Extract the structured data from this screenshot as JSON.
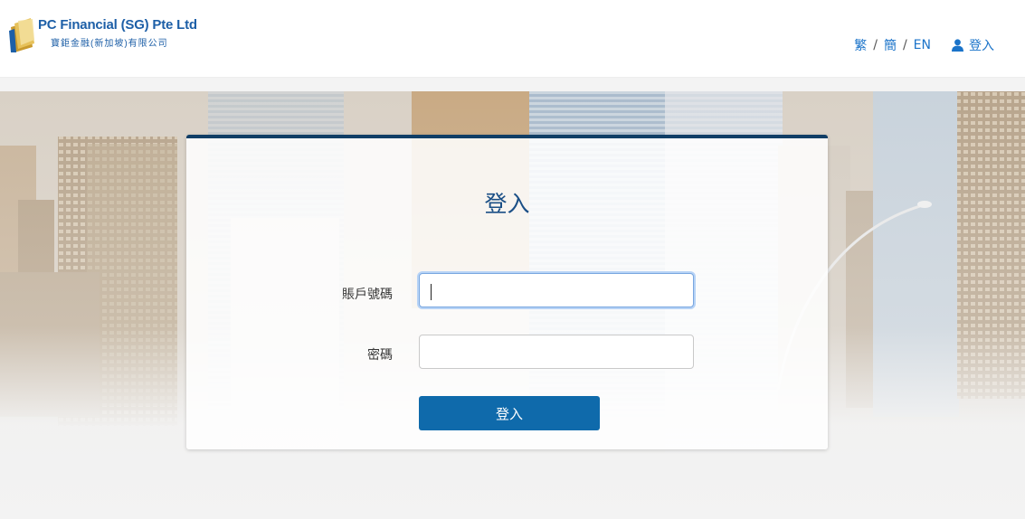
{
  "header": {
    "company_name": "PC Financial (SG) Pte Ltd",
    "company_name_cn": "寶鉅金融(新加坡)有限公司",
    "languages": [
      {
        "label": "繁"
      },
      {
        "label": "簡"
      },
      {
        "label": "EN"
      }
    ],
    "separator": "/",
    "login_link": "登入"
  },
  "login_form": {
    "title": "登入",
    "account_label": "賬戶號碼",
    "account_value": "",
    "password_label": "密碼",
    "password_value": "",
    "submit_label": "登入"
  },
  "colors": {
    "brand_blue": "#1d5fa7",
    "accent": "#0f6aab",
    "card_top_border": "#103e66",
    "link": "#1a73c9"
  }
}
